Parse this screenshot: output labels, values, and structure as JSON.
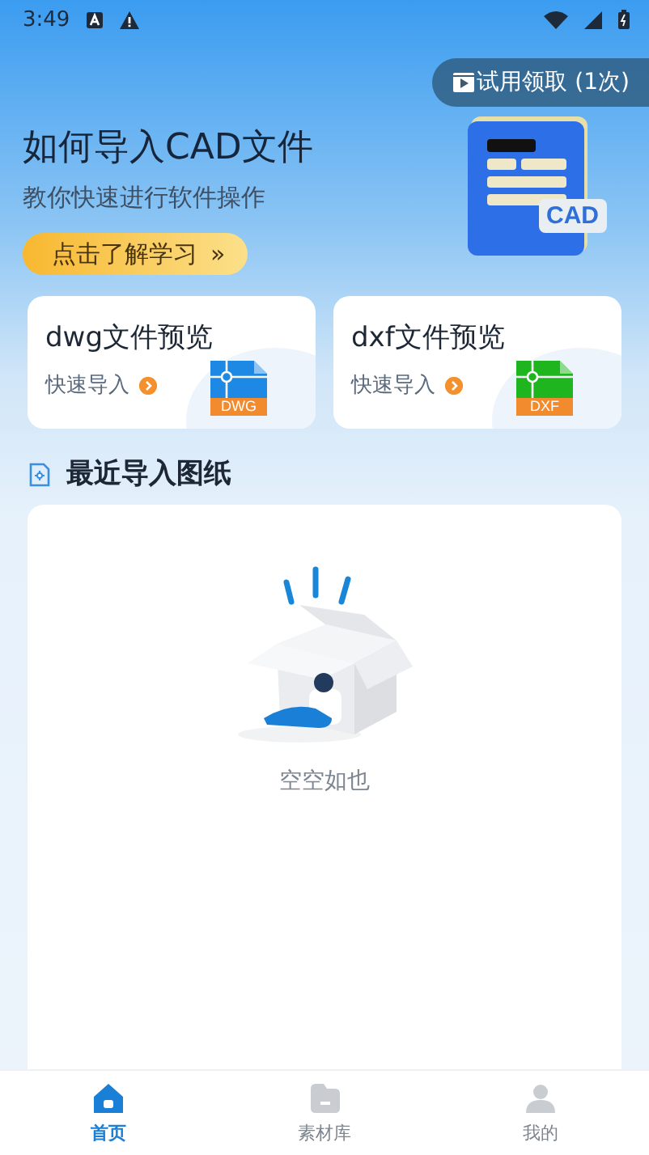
{
  "status_bar": {
    "time": "3:49"
  },
  "trial_button": {
    "label": "试用领取 (1次)"
  },
  "hero": {
    "title": "如何导入CAD文件",
    "subtitle": "教你快速进行软件操作",
    "button": "点击了解学习",
    "button_arrow": "»",
    "badge": "CAD"
  },
  "cards": [
    {
      "title": "dwg文件预览",
      "action": "快速导入",
      "file_label": "DWG",
      "color": "#1e88e5"
    },
    {
      "title": "dxf文件预览",
      "action": "快速导入",
      "file_label": "DXF",
      "color": "#1fb51f"
    }
  ],
  "recent": {
    "title": "最近导入图纸",
    "empty_text": "空空如也"
  },
  "tabs": [
    {
      "label": "首页",
      "selected": true,
      "kind": "home"
    },
    {
      "label": "素材库",
      "selected": false,
      "kind": "library"
    },
    {
      "label": "我的",
      "selected": false,
      "kind": "profile"
    }
  ]
}
